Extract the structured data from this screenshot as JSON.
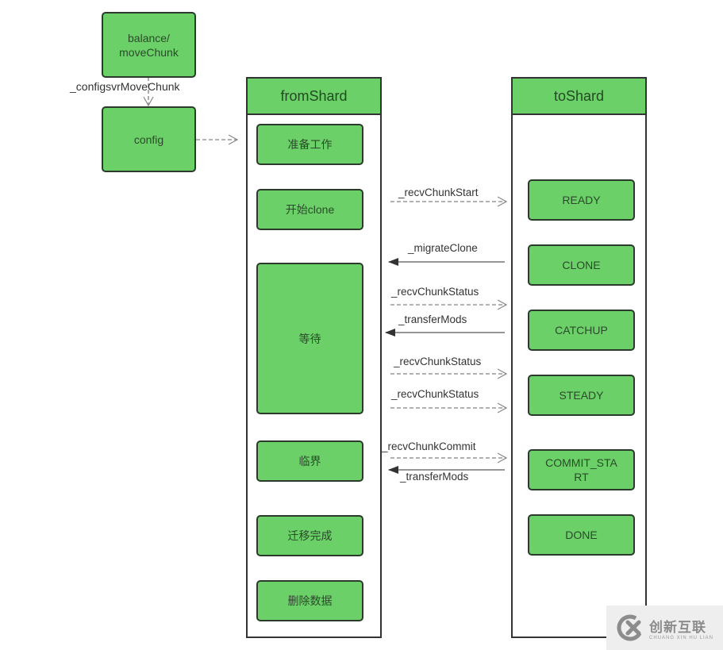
{
  "initiator": {
    "balance_node": [
      "balance/",
      "moveChunk"
    ],
    "config_call": "_configsvrMoveChunk",
    "config_node": "config"
  },
  "from_shard": {
    "title": "fromShard",
    "steps": [
      "准备工作",
      "开始clone",
      "等待",
      "临界",
      "迁移完成",
      "删除数据"
    ]
  },
  "to_shard": {
    "title": "toShard",
    "states": [
      "READY",
      "CLONE",
      "CATCHUP",
      "STEADY",
      "COMMIT_STA",
      "RT",
      "DONE"
    ]
  },
  "messages": [
    {
      "label": "_recvChunkStart",
      "direction": "to",
      "style": "dashed"
    },
    {
      "label": "_migrateClone",
      "direction": "from",
      "style": "solid"
    },
    {
      "label": "_recvChunkStatus",
      "direction": "to",
      "style": "dashed"
    },
    {
      "label": "_transferMods",
      "direction": "from",
      "style": "solid"
    },
    {
      "label": "_recvChunkStatus",
      "direction": "to",
      "style": "dashed"
    },
    {
      "label": "_recvChunkStatus",
      "direction": "to",
      "style": "dashed"
    },
    {
      "label": "_recvChunkCommit",
      "direction": "to",
      "style": "dashed"
    },
    {
      "label": "_transferMods",
      "direction": "from",
      "style": "solid"
    }
  ],
  "watermark": {
    "name": "创新互联",
    "sub": "CHUANG XIN HU LIAN"
  },
  "colors": {
    "node_fill": "#6ad067",
    "border": "#2b3a2b",
    "edge": "#999999"
  }
}
